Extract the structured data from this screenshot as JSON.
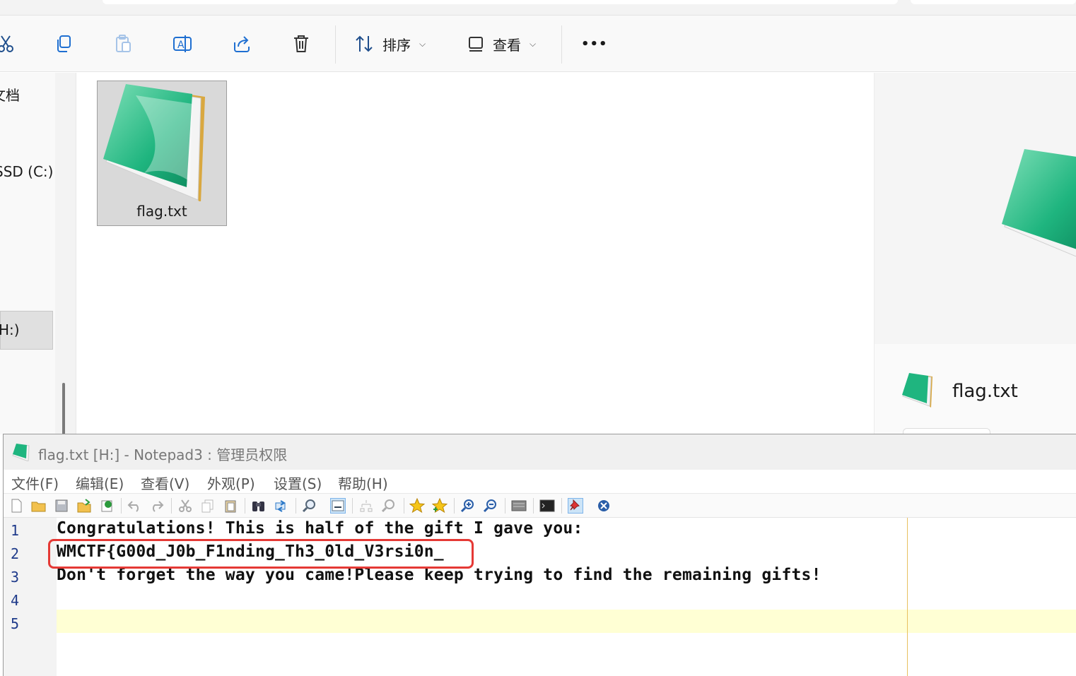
{
  "explorer": {
    "toolbar": {
      "sort_label": "排序",
      "view_label": "查看",
      "more_label": "•••"
    },
    "nav": {
      "items": [
        {
          "label": "文档"
        },
        {
          "label": "SSD (C:)"
        },
        {
          "label": "H:)"
        }
      ]
    },
    "file": {
      "name": "flag.txt"
    },
    "preview": {
      "name": "flag.txt"
    }
  },
  "notepad": {
    "title": "flag.txt [H:] - Notepad3 : 管理员权限",
    "menu": [
      "文件(F)",
      "编辑(E)",
      "查看(V)",
      "外观(P)",
      "设置(S)",
      "帮助(H)"
    ],
    "line_numbers": [
      "1",
      "2",
      "3",
      "4",
      "5"
    ],
    "lines": [
      "Congratulations! This is half of the gift I gave you:",
      "WMCTF{G00d_J0b_F1nding_Th3_0ld_V3rsi0n_",
      "Don't forget the way you came!Please keep trying to find the remaining gifts!",
      "",
      ""
    ]
  },
  "colors": {
    "highlight_box": "#e53935",
    "current_line": "#ffffd4",
    "line_number": "#1e3a8a",
    "notepad_icon": "#1fb57f"
  }
}
